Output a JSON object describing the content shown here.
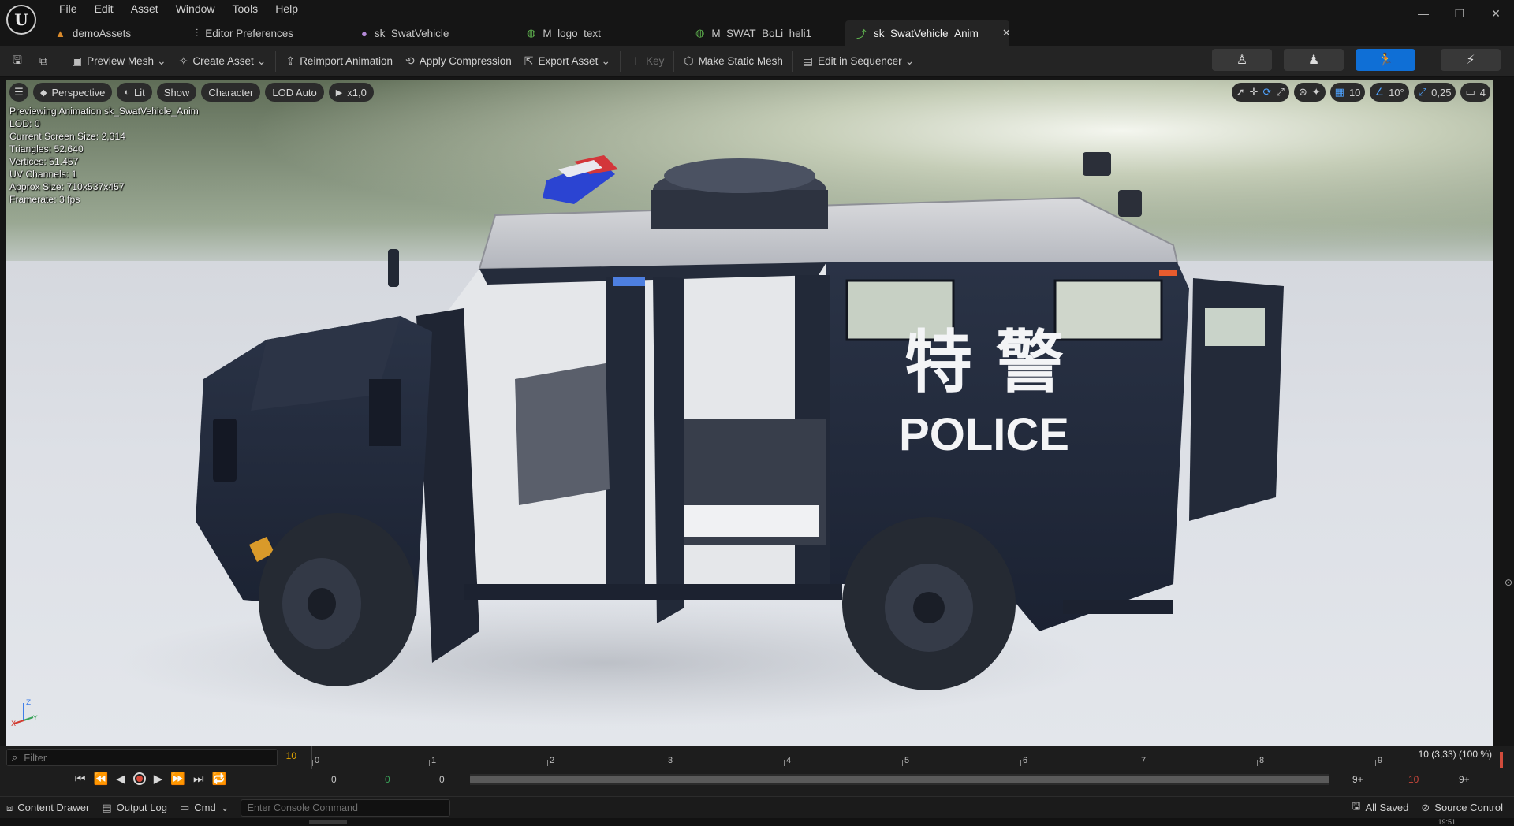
{
  "menu": {
    "logo": "U",
    "items": [
      "File",
      "Edit",
      "Asset",
      "Window",
      "Tools",
      "Help"
    ]
  },
  "window_controls": {
    "minimize": "—",
    "restore": "❐",
    "close": "✕"
  },
  "tabs": [
    {
      "label": "demoAssets",
      "icon": "folder-icon",
      "icon_char": "▲",
      "color": "#d98a2b"
    },
    {
      "label": "Editor Preferences",
      "icon": "sliders-icon",
      "icon_char": "⫶",
      "color": "#c8c8c8"
    },
    {
      "label": "sk_SwatVehicle",
      "icon": "skeletal-mesh-icon",
      "icon_char": "●",
      "color": "#b58ad8"
    },
    {
      "label": "M_logo_text",
      "icon": "material-icon",
      "icon_char": "◍",
      "color": "#5fb34f"
    },
    {
      "label": "M_SWAT_BoLi_heli1",
      "icon": "material-icon",
      "icon_char": "◍",
      "color": "#5fb34f"
    },
    {
      "label": "sk_SwatVehicle_Anim",
      "icon": "animation-icon",
      "icon_char": "⤴",
      "color": "#5fb34f",
      "active": true,
      "close": "✕"
    }
  ],
  "toolbar": {
    "save_icon": "save-icon",
    "browse_icon": "browse-icon",
    "preview_mesh": "Preview Mesh",
    "create_asset": "Create Asset",
    "reimport": "Reimport Animation",
    "apply_compression": "Apply Compression",
    "export_asset": "Export Asset",
    "key": "Key",
    "make_static_mesh": "Make Static Mesh",
    "edit_in_sequencer": "Edit in Sequencer"
  },
  "modes": [
    "skeleton-mode-icon",
    "mesh-mode-icon",
    "animation-mode-icon",
    "physics-mode-icon"
  ],
  "viewport": {
    "toolbar": {
      "menu": "☰",
      "perspective": "Perspective",
      "lit": "Lit",
      "show": "Show",
      "character": "Character",
      "lod": "LOD Auto",
      "speed": "x1,0"
    },
    "right_tools": {
      "grid": "10",
      "angle": "10°",
      "scale": "0,25",
      "camera_speed": "4"
    },
    "stats": [
      "Previewing Animation sk_SwatVehicle_Anim",
      "LOD: 0",
      "Current Screen Size: 2,314",
      "Triangles: 52.640",
      "Vertices: 51.457",
      "UV Channels: 1",
      "Approx Size: 710x537x457",
      "Framerate: 3 fps"
    ],
    "vehicle_text": {
      "chinese": "特 警",
      "police": "POLICE"
    },
    "axis": {
      "x": "X",
      "y": "Y",
      "z": "Z"
    }
  },
  "timeline": {
    "filter_placeholder": "Filter",
    "count": "10",
    "ticks": [
      "0",
      "1",
      "2",
      "3",
      "4",
      "5",
      "6",
      "7",
      "8",
      "9"
    ],
    "current_time": "10 (3,33) (100 %)",
    "start": "0",
    "playback_start": "0",
    "playback_end": "0",
    "end_left": "9+",
    "end_red": "10",
    "end_right": "9+"
  },
  "statusbar": {
    "content_drawer": "Content Drawer",
    "output_log": "Output Log",
    "cmd": "Cmd",
    "console_placeholder": "Enter Console Command",
    "all_saved": "All Saved",
    "source_control": "Source Control"
  },
  "clock": "19:51"
}
